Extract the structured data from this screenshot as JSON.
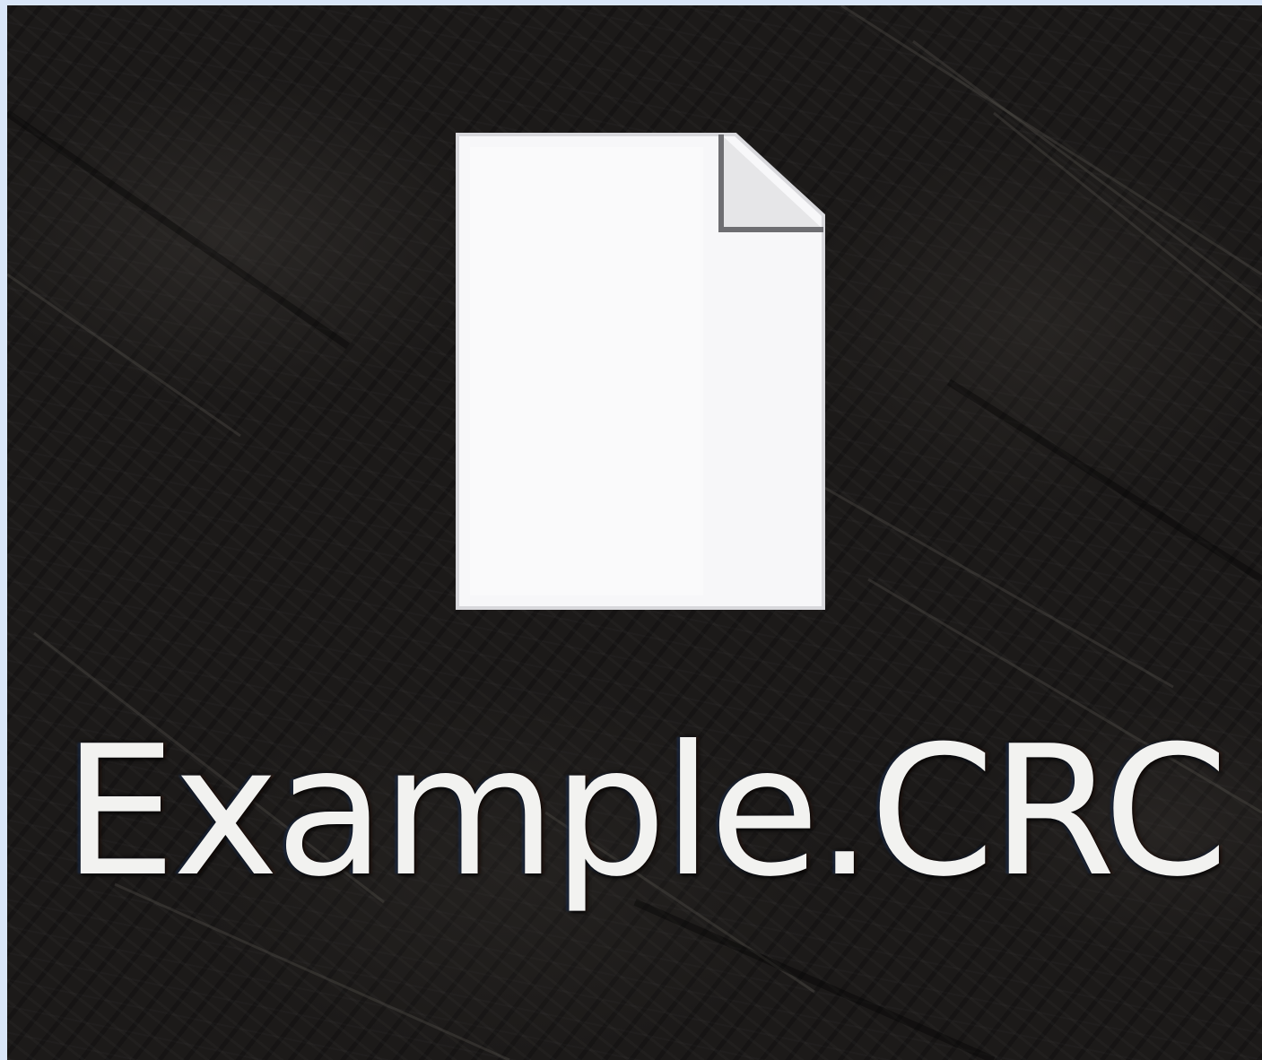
{
  "desktop": {
    "icon": {
      "label": "Example.CRC",
      "icon_type": "blank-document-icon",
      "colors": {
        "page_fill": "#f7f7f9",
        "fold_fill": "#e6e6e8",
        "label_text": "#f2f2f0",
        "wallpaper_base": "#1c1a19"
      }
    }
  }
}
